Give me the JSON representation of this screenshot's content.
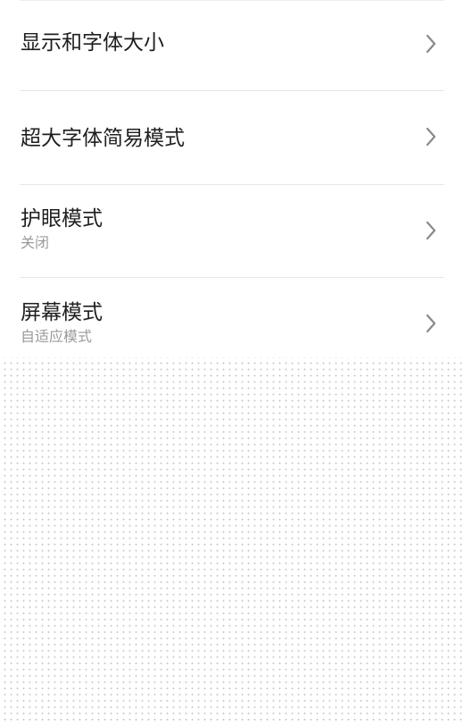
{
  "settings": {
    "items": [
      {
        "title": "显示和字体大小",
        "subtitle": ""
      },
      {
        "title": "超大字体简易模式",
        "subtitle": ""
      },
      {
        "title": "护眼模式",
        "subtitle": "关闭"
      },
      {
        "title": "屏幕模式",
        "subtitle": "自适应模式"
      }
    ]
  },
  "icons": {
    "row_chevron": "chevron-right-icon"
  },
  "colors": {
    "title_text": "#1f1f1f",
    "subtitle_text": "#9a9a9a",
    "divider": "#e6e6e6",
    "chevron": "#8a8a8a"
  }
}
